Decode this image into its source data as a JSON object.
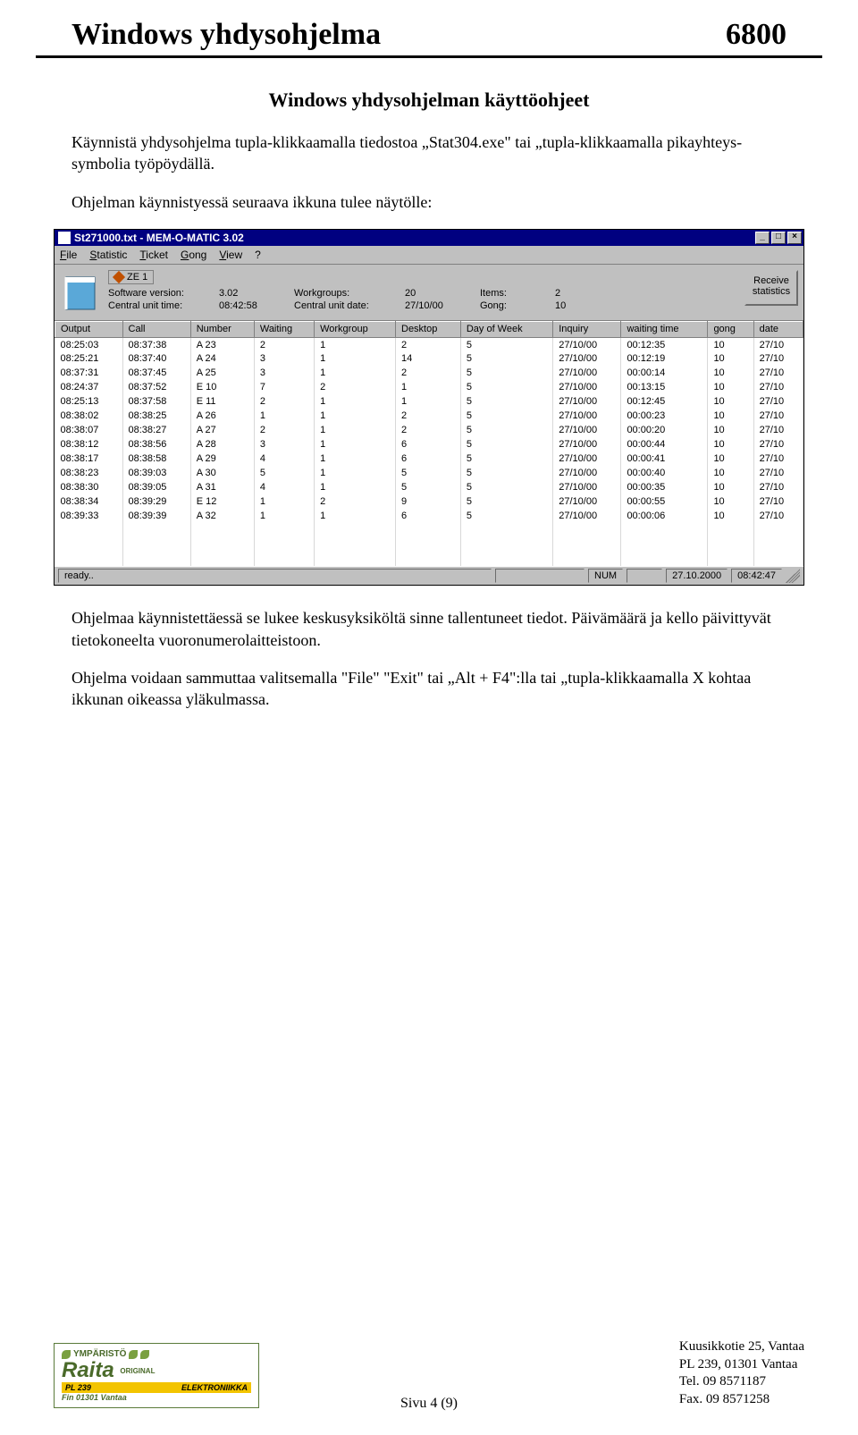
{
  "header": {
    "title": "Windows yhdysohjelma",
    "page_number": "6800"
  },
  "subtitle": "Windows yhdysohjelman käyttöohjeet",
  "paragraphs": {
    "p1": "Käynnistä yhdysohjelma tupla-klikkaamalla tiedostoa „Stat304.exe\" tai „tupla-klikkaamalla pikayhteys-symbolia työpöydällä.",
    "p2": "Ohjelman käynnistyessä seuraava ikkuna tulee näytölle:",
    "p3": "Ohjelmaa käynnistettäessä se lukee keskusyksiköltä sinne tallentuneet tiedot. Päivämäärä ja kello päivittyvät tietokoneelta vuoronumerolaitteistoon.",
    "p4": "Ohjelma voidaan sammuttaa valitsemalla \"File\" \"Exit\" tai „Alt + F4\":lla tai „tupla-klikkaamalla X kohtaa ikkunan oikeassa yläkulmassa."
  },
  "app": {
    "title": "St271000.txt - MEM-O-MATIC 3.02",
    "menu": {
      "file": "File",
      "statistic": "Statistic",
      "ticket": "Ticket",
      "gong": "Gong",
      "view": "View",
      "help": "?"
    },
    "badge": "ZE 1",
    "labels": {
      "software_version": "Software version:",
      "workgroups": "Workgroups:",
      "items": "Items:",
      "central_unit_time": "Central unit time:",
      "central_unit_date": "Central unit date:",
      "gong": "Gong:"
    },
    "values": {
      "software_version": "3.02",
      "workgroups": "20",
      "items": "2",
      "central_unit_time": "08:42:58",
      "central_unit_date": "27/10/00",
      "gong": "10"
    },
    "receive_button": "Receive statistics",
    "columns": [
      "Output",
      "Call",
      "Number",
      "Waiting",
      "Workgroup",
      "Desktop",
      "Day of Week",
      "Inquiry",
      "waiting time",
      "gong",
      "date"
    ],
    "rows": [
      [
        "08:25:03",
        "08:37:38",
        "A 23",
        "2",
        "1",
        "2",
        "5",
        "27/10/00",
        "00:12:35",
        "10",
        "27/10"
      ],
      [
        "08:25:21",
        "08:37:40",
        "A 24",
        "3",
        "1",
        "14",
        "5",
        "27/10/00",
        "00:12:19",
        "10",
        "27/10"
      ],
      [
        "08:37:31",
        "08:37:45",
        "A 25",
        "3",
        "1",
        "2",
        "5",
        "27/10/00",
        "00:00:14",
        "10",
        "27/10"
      ],
      [
        "08:24:37",
        "08:37:52",
        "E 10",
        "7",
        "2",
        "1",
        "5",
        "27/10/00",
        "00:13:15",
        "10",
        "27/10"
      ],
      [
        "08:25:13",
        "08:37:58",
        "E 11",
        "2",
        "1",
        "1",
        "5",
        "27/10/00",
        "00:12:45",
        "10",
        "27/10"
      ],
      [
        "08:38:02",
        "08:38:25",
        "A 26",
        "1",
        "1",
        "2",
        "5",
        "27/10/00",
        "00:00:23",
        "10",
        "27/10"
      ],
      [
        "08:38:07",
        "08:38:27",
        "A 27",
        "2",
        "1",
        "2",
        "5",
        "27/10/00",
        "00:00:20",
        "10",
        "27/10"
      ],
      [
        "08:38:12",
        "08:38:56",
        "A 28",
        "3",
        "1",
        "6",
        "5",
        "27/10/00",
        "00:00:44",
        "10",
        "27/10"
      ],
      [
        "08:38:17",
        "08:38:58",
        "A 29",
        "4",
        "1",
        "6",
        "5",
        "27/10/00",
        "00:00:41",
        "10",
        "27/10"
      ],
      [
        "08:38:23",
        "08:39:03",
        "A 30",
        "5",
        "1",
        "5",
        "5",
        "27/10/00",
        "00:00:40",
        "10",
        "27/10"
      ],
      [
        "08:38:30",
        "08:39:05",
        "A 31",
        "4",
        "1",
        "5",
        "5",
        "27/10/00",
        "00:00:35",
        "10",
        "27/10"
      ],
      [
        "08:38:34",
        "08:39:29",
        "E 12",
        "1",
        "2",
        "9",
        "5",
        "27/10/00",
        "00:00:55",
        "10",
        "27/10"
      ],
      [
        "08:39:33",
        "08:39:39",
        "A 32",
        "1",
        "1",
        "6",
        "5",
        "27/10/00",
        "00:00:06",
        "10",
        "27/10"
      ]
    ],
    "status": {
      "ready": "ready..",
      "num": "NUM",
      "date": "27.10.2000",
      "time": "08:42:47"
    }
  },
  "footer": {
    "sivu": "Sivu 4 (9)",
    "logo": {
      "ymparisto": "YMPÄRISTÖ",
      "name": "Raita",
      "original": "ORIGINAL",
      "pl": "PL 239",
      "fin": "Fin 01301 Vantaa",
      "elektroniikka": "ELEKTRONIIKKA"
    },
    "address": {
      "l1": "Kuusikkotie 25, Vantaa",
      "l2": "PL 239, 01301 Vantaa",
      "l3": "Tel. 09 8571187",
      "l4": "Fax. 09 8571258"
    }
  }
}
